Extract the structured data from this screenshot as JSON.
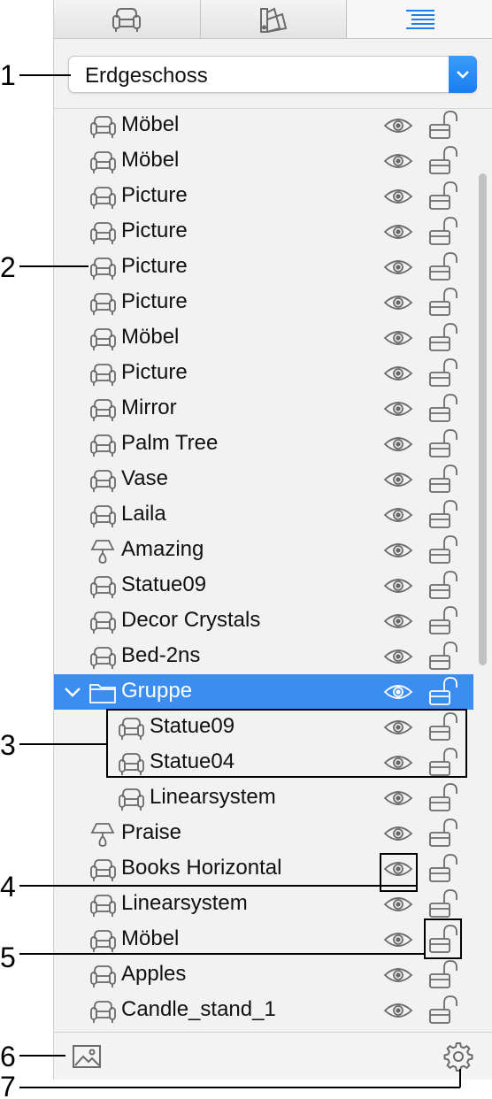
{
  "tabs": [
    {
      "name": "furniture-tab",
      "icon": "armchair-icon"
    },
    {
      "name": "materials-tab",
      "icon": "color-swatches-icon"
    },
    {
      "name": "list-tab",
      "icon": "list-icon",
      "active": true
    }
  ],
  "level_select": {
    "value": "Erdgeschoss"
  },
  "items": [
    {
      "label": "Möbel",
      "icon": "armchair-icon"
    },
    {
      "label": "Möbel",
      "icon": "armchair-icon"
    },
    {
      "label": "Picture",
      "icon": "armchair-icon"
    },
    {
      "label": "Picture",
      "icon": "armchair-icon"
    },
    {
      "label": "Picture",
      "icon": "armchair-icon"
    },
    {
      "label": "Picture",
      "icon": "armchair-icon"
    },
    {
      "label": "Möbel",
      "icon": "armchair-icon"
    },
    {
      "label": "Picture",
      "icon": "armchair-icon"
    },
    {
      "label": "Mirror",
      "icon": "armchair-icon"
    },
    {
      "label": "Palm Tree",
      "icon": "armchair-icon"
    },
    {
      "label": "Vase",
      "icon": "armchair-icon"
    },
    {
      "label": "Laila",
      "icon": "armchair-icon"
    },
    {
      "label": "Amazing",
      "icon": "lamp-icon"
    },
    {
      "label": "Statue09",
      "icon": "armchair-icon"
    },
    {
      "label": "Decor Crystals",
      "icon": "armchair-icon"
    },
    {
      "label": "Bed-2ns",
      "icon": "armchair-icon"
    },
    {
      "label": "Gruppe",
      "icon": "folder-icon",
      "group": true,
      "expanded": true,
      "selected": true
    },
    {
      "label": "Statue09",
      "icon": "armchair-icon",
      "indent": 1
    },
    {
      "label": "Statue04",
      "icon": "armchair-icon",
      "indent": 1
    },
    {
      "label": "Linearsystem",
      "icon": "armchair-icon",
      "indent": 1
    },
    {
      "label": "Praise",
      "icon": "lamp-icon"
    },
    {
      "label": "Books Horizontal",
      "icon": "armchair-icon"
    },
    {
      "label": "Linearsystem",
      "icon": "armchair-icon"
    },
    {
      "label": "Möbel",
      "icon": "armchair-icon"
    },
    {
      "label": "Apples",
      "icon": "armchair-icon"
    },
    {
      "label": "Candle_stand_1",
      "icon": "armchair-icon"
    }
  ],
  "bottom_bar": {
    "left_icon": "image-icon",
    "right_icon": "gear-icon"
  },
  "callouts": [
    "1",
    "2",
    "3",
    "4",
    "5",
    "6",
    "7"
  ],
  "colors": {
    "selection": "#3b8ef0",
    "accent": "#1a7ef0",
    "icon_gray": "#6b6b6b"
  }
}
